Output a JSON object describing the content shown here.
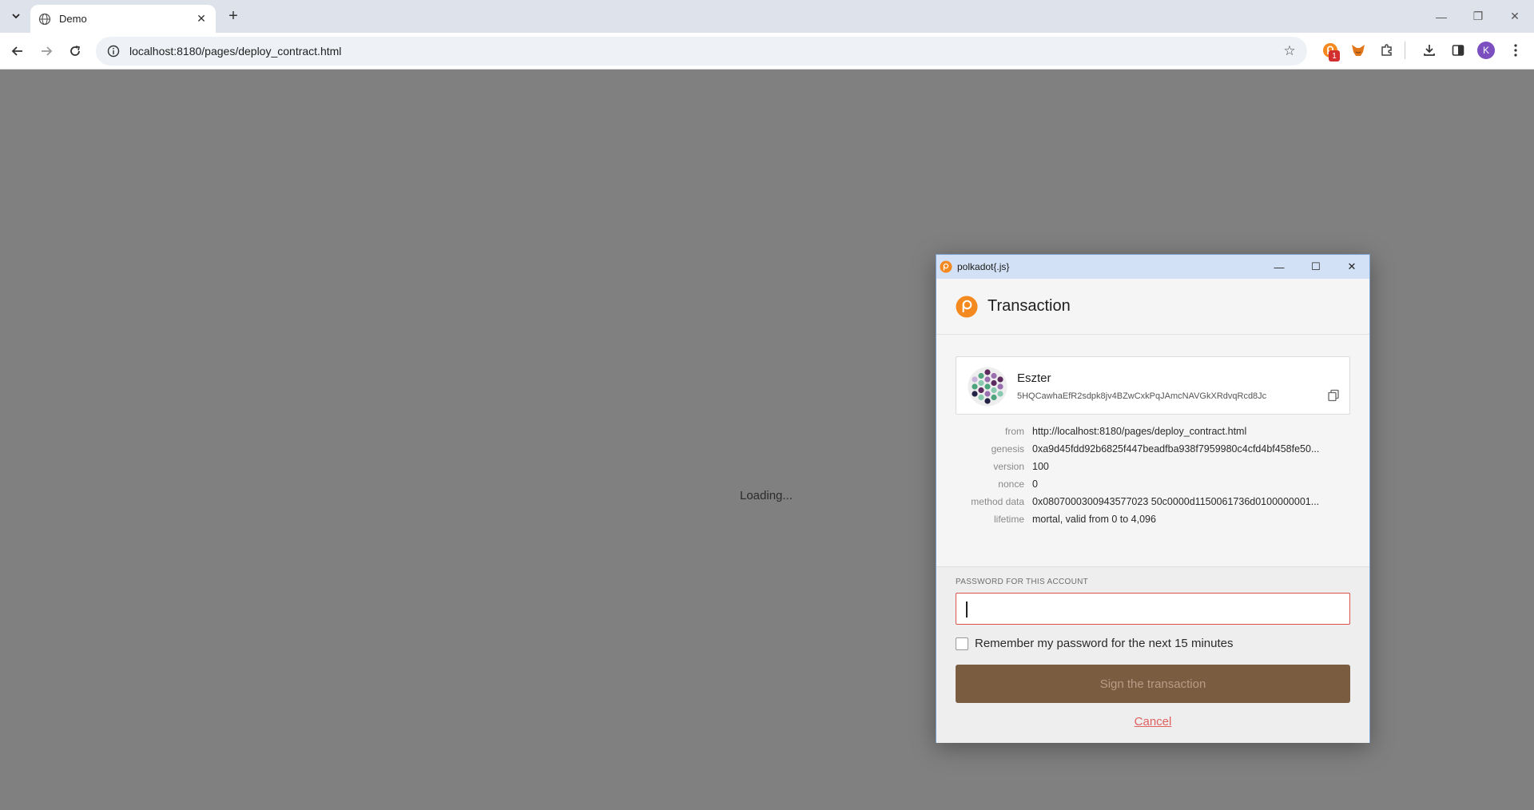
{
  "browser": {
    "tab_title": "Demo",
    "url": "localhost:8180/pages/deploy_contract.html",
    "extension_badge": "1",
    "profile_initial": "K"
  },
  "page": {
    "loading_text": "Loading..."
  },
  "popup": {
    "window_title": "polkadot{.js}",
    "heading": "Transaction",
    "account": {
      "name": "Eszter",
      "address": "5HQCawhaEfR2sdpk8jv4BZwCxkPqJAmcNAVGkXRdvqRcd8Jc"
    },
    "details": [
      {
        "label": "from",
        "value": "http://localhost:8180/pages/deploy_contract.html"
      },
      {
        "label": "genesis",
        "value": "0xa9d45fdd92b6825f447beadfba938f7959980c4cfd4bf458fe50..."
      },
      {
        "label": "version",
        "value": "100"
      },
      {
        "label": "nonce",
        "value": "0"
      },
      {
        "label": "method data",
        "value": "0x0807000300943577023 50c0000d1150061736d0100000001..."
      },
      {
        "label": "lifetime",
        "value": "mortal, valid from 0 to 4,096"
      }
    ],
    "password_label": "PASSWORD FOR THIS ACCOUNT",
    "password_value": "",
    "remember_label": "Remember my password for the next 15 minutes",
    "sign_button": "Sign the transaction",
    "cancel_link": "Cancel"
  },
  "colors": {
    "page_overlay": "#808080",
    "sign_button_bg": "#7a5c40",
    "cancel_link": "#e06060",
    "input_error_border": "#d9534f",
    "polkadot_orange": "#f4891f"
  }
}
